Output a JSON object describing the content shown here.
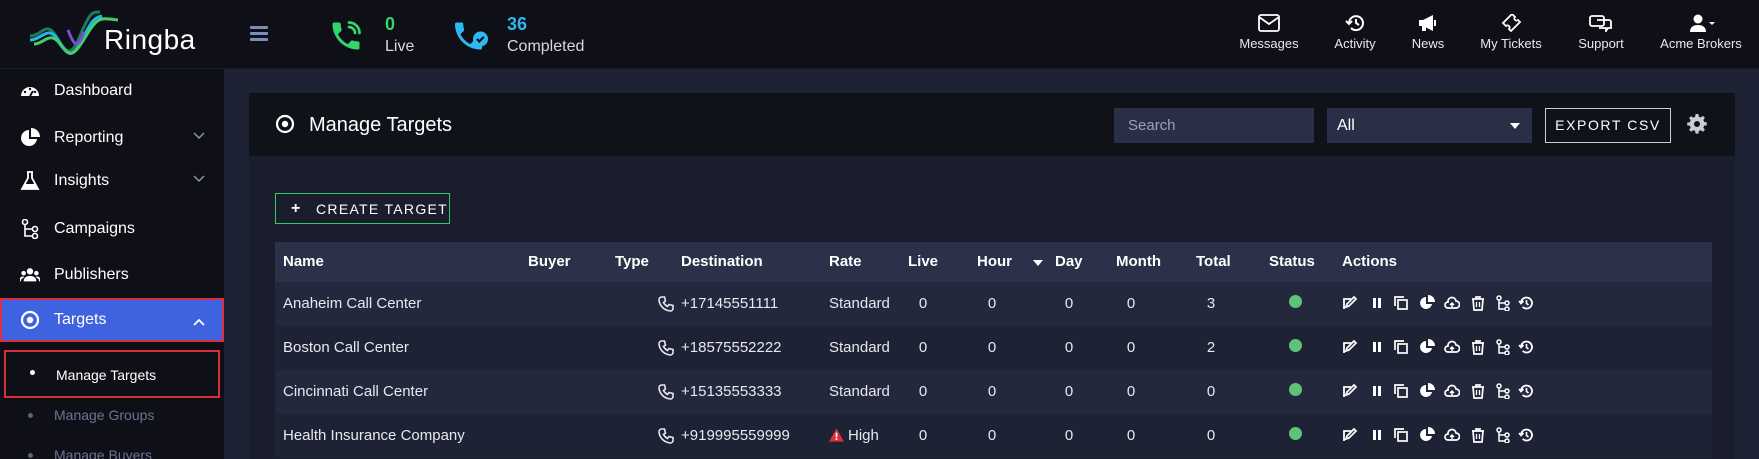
{
  "app": {
    "name": "Ringba"
  },
  "header": {
    "live": {
      "count": "0",
      "label": "Live"
    },
    "completed": {
      "count": "36",
      "label": "Completed"
    },
    "nav": [
      {
        "label": "Messages",
        "icon": "envelope-icon"
      },
      {
        "label": "Activity",
        "icon": "history-icon"
      },
      {
        "label": "News",
        "icon": "megaphone-icon"
      },
      {
        "label": "My Tickets",
        "icon": "ticket-icon"
      },
      {
        "label": "Support",
        "icon": "chat-icon"
      },
      {
        "label": "Acme Brokers",
        "icon": "user-icon"
      }
    ]
  },
  "sidebar": {
    "items": [
      {
        "label": "Dashboard",
        "icon": "dashboard-icon"
      },
      {
        "label": "Reporting",
        "icon": "pie-chart-icon",
        "expandable": true
      },
      {
        "label": "Insights",
        "icon": "flask-icon",
        "expandable": true
      },
      {
        "label": "Campaigns",
        "icon": "campaign-tree-icon"
      },
      {
        "label": "Publishers",
        "icon": "users-icon"
      },
      {
        "label": "Targets",
        "icon": "target-icon",
        "expandable": true,
        "active": true
      }
    ],
    "subitems": [
      {
        "label": "Manage Targets",
        "active": true
      },
      {
        "label": "Manage Groups",
        "active": false
      },
      {
        "label": "Manage Buyers",
        "active": false
      }
    ]
  },
  "main": {
    "title": "Manage Targets",
    "search_placeholder": "Search",
    "filter_value": "All",
    "export_label": "EXPORT CSV",
    "create_label": "CREATE TARGET"
  },
  "table": {
    "columns": [
      "Name",
      "Buyer",
      "Type",
      "Destination",
      "Rate",
      "Live",
      "Hour",
      "Day",
      "Month",
      "Total",
      "Status",
      "Actions"
    ],
    "rows": [
      {
        "name": "Anaheim Call Center",
        "buyer": "",
        "destination": "+17145551111",
        "rate": "Standard",
        "live": "0",
        "hour": "0",
        "day": "0",
        "month": "0",
        "total": "3",
        "status": "active"
      },
      {
        "name": "Boston Call Center",
        "buyer": "",
        "destination": "+18575552222",
        "rate": "Standard",
        "live": "0",
        "hour": "0",
        "day": "0",
        "month": "0",
        "total": "2",
        "status": "active"
      },
      {
        "name": "Cincinnati Call Center",
        "buyer": "",
        "destination": "+15135553333",
        "rate": "Standard",
        "live": "0",
        "hour": "0",
        "day": "0",
        "month": "0",
        "total": "0",
        "status": "active"
      },
      {
        "name": "Health Insurance Company",
        "buyer": "",
        "destination": "+919995559999",
        "rate": "High",
        "rate_warning": true,
        "live": "0",
        "hour": "0",
        "day": "0",
        "month": "0",
        "total": "0",
        "status": "active"
      }
    ]
  },
  "colors": {
    "accent": "#3f63e0",
    "highlight": "#d9303d",
    "live_green": "#35d46a",
    "completed_blue": "#2fb8f0",
    "status_green": "#5fc37a",
    "warning_red": "#d9303d"
  }
}
